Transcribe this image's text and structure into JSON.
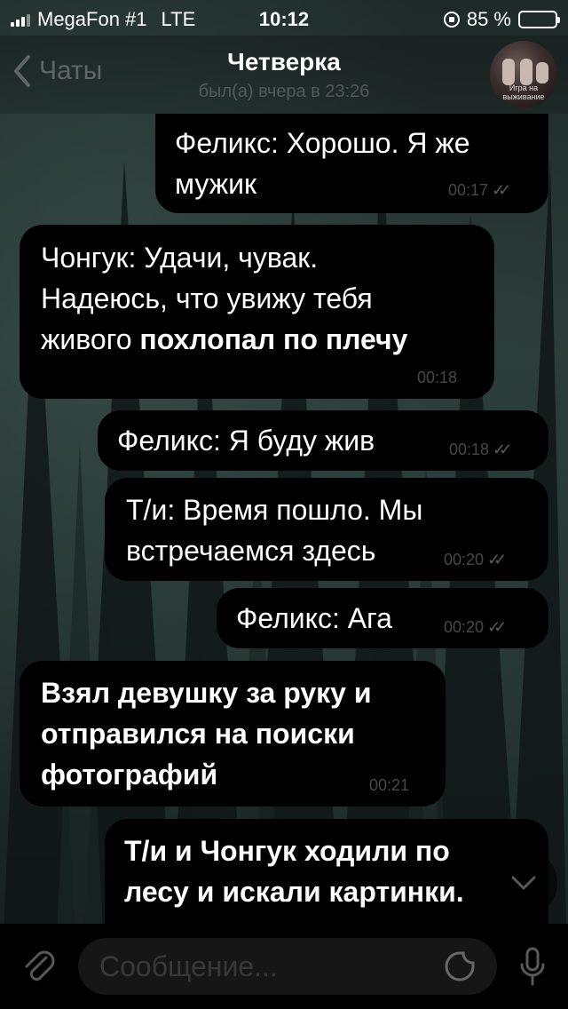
{
  "status": {
    "carrier": "MegaFon #1",
    "network": "LTE",
    "time": "10:12",
    "battery": "85 %",
    "battery_level": 0.85,
    "accent": "#f5c518"
  },
  "nav": {
    "back_label": "Чаты",
    "title": "Четверка",
    "subtitle": "был(а) вчера в 23:26",
    "avatar_caption": "Игра на выживание"
  },
  "messages": [
    {
      "kind": "out",
      "lines": [
        "Феликс: Хорошо. Я же",
        "мужик"
      ],
      "time": "00:17"
    },
    {
      "kind": "in",
      "lines": [
        "Чонгук: Удачи, чувак.",
        "Надеюсь, что увижу тебя"
      ],
      "line3_plain": "живого ",
      "line3_bold": "похлопал по плечу",
      "time": "00:18"
    },
    {
      "kind": "out",
      "lines": [
        "Феликс: Я буду жив"
      ],
      "time": "00:18"
    },
    {
      "kind": "out",
      "lines": [
        "Т/и: Время пошло. Мы",
        "встречаемся здесь"
      ],
      "time": "00:20"
    },
    {
      "kind": "out",
      "lines": [
        "Феликс: Ага"
      ],
      "time": "00:20"
    },
    {
      "kind": "in",
      "lines": [
        "Взял девушку за руку и",
        "отправился на поиски",
        "фотографий"
      ],
      "time": "00:21"
    },
    {
      "kind": "out",
      "lines": [
        "Т/и и Чонгук ходили по",
        "лесу и искали картинки."
      ]
    }
  ],
  "input": {
    "placeholder": "Сообщение..."
  },
  "icons": {
    "back": "chevron-left-icon",
    "attach": "paperclip-icon",
    "sticker": "sticker-icon",
    "mic": "microphone-icon",
    "scroll": "chevron-down-icon",
    "read": "double-check-icon"
  }
}
